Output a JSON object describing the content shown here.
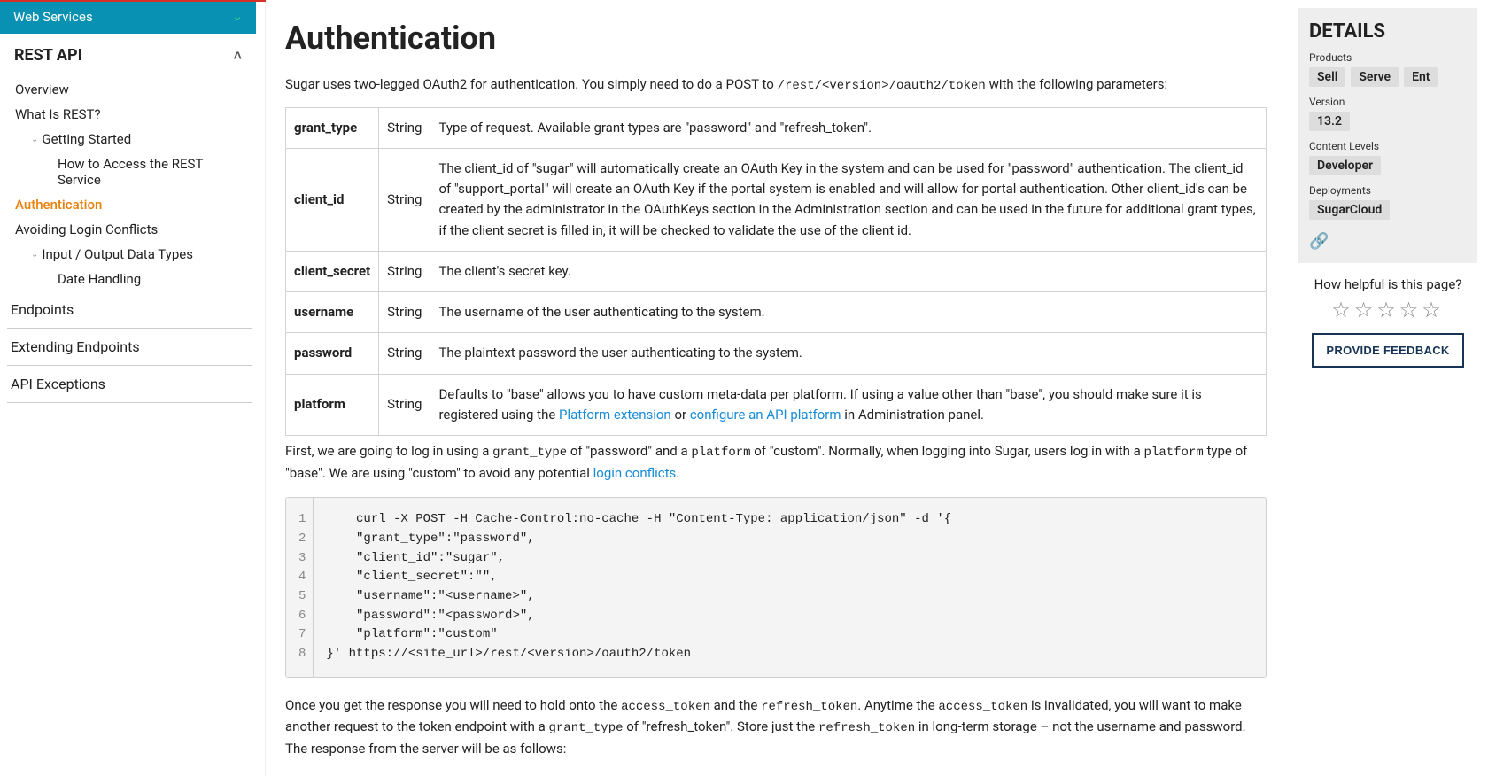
{
  "sidebar": {
    "header": "Web Services",
    "section_title": "REST API",
    "items": [
      {
        "label": "Overview"
      },
      {
        "label": "What Is REST?"
      },
      {
        "label": "Getting Started"
      },
      {
        "label": "How to Access the REST Service"
      },
      {
        "label": "Authentication"
      },
      {
        "label": "Avoiding Login Conflicts"
      },
      {
        "label": "Input / Output Data Types"
      },
      {
        "label": "Date Handling"
      }
    ],
    "lower_items": [
      "Endpoints",
      "Extending Endpoints",
      "API Exceptions"
    ]
  },
  "main": {
    "title": "Authentication",
    "intro_pre": "Sugar uses two-legged OAuth2 for authentication. You simply need to do a POST to ",
    "intro_code": "/rest/<version>/oauth2/token",
    "intro_post": " with the following parameters:",
    "table": [
      {
        "name": "grant_type",
        "type": "String",
        "desc": "Type of request. Available grant types are \"password\" and \"refresh_token\"."
      },
      {
        "name": "client_id",
        "type": "String",
        "desc": "The client_id of \"sugar\" will automatically create an OAuth Key in the system and can be used for \"password\" authentication. The client_id of \"support_portal\" will create an OAuth Key if the portal system is enabled and will allow for portal authentication. Other client_id's can be created by the administrator in the OAuthKeys section in the Administration section and can be used in the future for additional grant types, if the client secret is filled in, it will be checked to validate the use of the client id."
      },
      {
        "name": "client_secret",
        "type": "String",
        "desc": "The client's secret key."
      },
      {
        "name": "username",
        "type": "String",
        "desc": "The username of the user authenticating to the system."
      },
      {
        "name": "password",
        "type": "String",
        "desc": "The plaintext password the user authenticating to the system."
      }
    ],
    "platform_row": {
      "name": "platform",
      "type": "String",
      "desc_pre": "Defaults to \"base\" allows you to have custom meta-data per platform. If using a value other than \"base\", you should make sure it is registered using the ",
      "link1": "Platform extension",
      "mid": " or ",
      "link2": "configure an API platform",
      "desc_post": " in Administration panel."
    },
    "para_after_table": {
      "p1": "First, we are going to log in using a ",
      "c1": "grant_type",
      "p2": " of \"password\" and a ",
      "c2": "platform",
      "p3": " of \"custom\". Normally, when logging into Sugar, users log in with a ",
      "c3": "platform",
      "p4": " type of \"base\". We are using \"custom\" to avoid any potential ",
      "link": "login conflicts",
      "p5": "."
    },
    "code_lines": [
      "    curl -X POST -H Cache-Control:no-cache -H \"Content-Type: application/json\" -d '{",
      "    \"grant_type\":\"password\",",
      "    \"client_id\":\"sugar\",",
      "    \"client_secret\":\"\",",
      "    \"username\":\"<username>\",",
      "    \"password\":\"<password>\",",
      "    \"platform\":\"custom\"",
      "}' https://<site_url>/rest/<version>/oauth2/token"
    ],
    "after_code": {
      "p1": "Once you get the response you will need to hold onto the ",
      "c1": "access_token",
      "p2": " and the ",
      "c2": "refresh_token",
      "p3": ". Anytime the ",
      "c3": "access_token",
      "p4": " is invalidated, you will want to make another request to the token endpoint with a ",
      "c4": "grant_type",
      "p5": " of \"refresh_token\". Store just the ",
      "c5": "refresh_token",
      "p6": " in long-term storage – not the username and password. The response from the server will be as follows:"
    }
  },
  "details": {
    "title": "DETAILS",
    "products_label": "Products",
    "products": [
      "Sell",
      "Serve",
      "Ent"
    ],
    "version_label": "Version",
    "version": "13.2",
    "content_levels_label": "Content Levels",
    "content_levels": [
      "Developer"
    ],
    "deployments_label": "Deployments",
    "deployments": [
      "SugarCloud"
    ],
    "helpful": "How helpful is this page?",
    "feedback_button": "PROVIDE FEEDBACK"
  }
}
